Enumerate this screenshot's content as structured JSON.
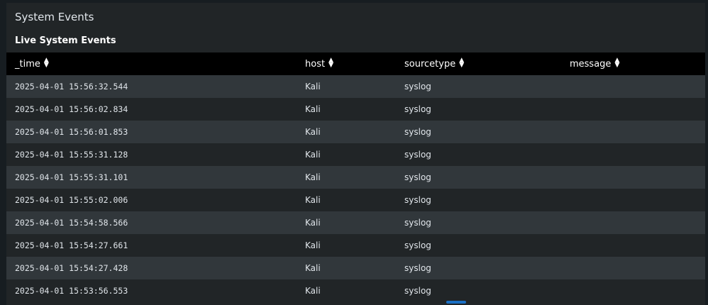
{
  "panel": {
    "title": "System Events",
    "viz_title": "Live System Events"
  },
  "table": {
    "columns": [
      "_time",
      "host",
      "sourcetype",
      "message"
    ],
    "rows": [
      {
        "_time": "2025-04-01 15:56:32.544",
        "host": "Kali",
        "sourcetype": "syslog",
        "message": ""
      },
      {
        "_time": "2025-04-01 15:56:02.834",
        "host": "Kali",
        "sourcetype": "syslog",
        "message": ""
      },
      {
        "_time": "2025-04-01 15:56:01.853",
        "host": "Kali",
        "sourcetype": "syslog",
        "message": ""
      },
      {
        "_time": "2025-04-01 15:55:31.128",
        "host": "Kali",
        "sourcetype": "syslog",
        "message": ""
      },
      {
        "_time": "2025-04-01 15:55:31.101",
        "host": "Kali",
        "sourcetype": "syslog",
        "message": ""
      },
      {
        "_time": "2025-04-01 15:55:02.006",
        "host": "Kali",
        "sourcetype": "syslog",
        "message": ""
      },
      {
        "_time": "2025-04-01 15:54:58.566",
        "host": "Kali",
        "sourcetype": "syslog",
        "message": ""
      },
      {
        "_time": "2025-04-01 15:54:27.661",
        "host": "Kali",
        "sourcetype": "syslog",
        "message": ""
      },
      {
        "_time": "2025-04-01 15:54:27.428",
        "host": "Kali",
        "sourcetype": "syslog",
        "message": ""
      },
      {
        "_time": "2025-04-01 15:53:56.553",
        "host": "Kali",
        "sourcetype": "syslog",
        "message": ""
      }
    ]
  },
  "icons": {
    "sort": "sort-icon"
  },
  "colors": {
    "background": "#171d21",
    "panel": "#212527",
    "header_row": "#000000",
    "row_odd": "#31373b",
    "row_even": "#212527",
    "text": "#e1e6eb",
    "accent": "#1a6fc4"
  }
}
